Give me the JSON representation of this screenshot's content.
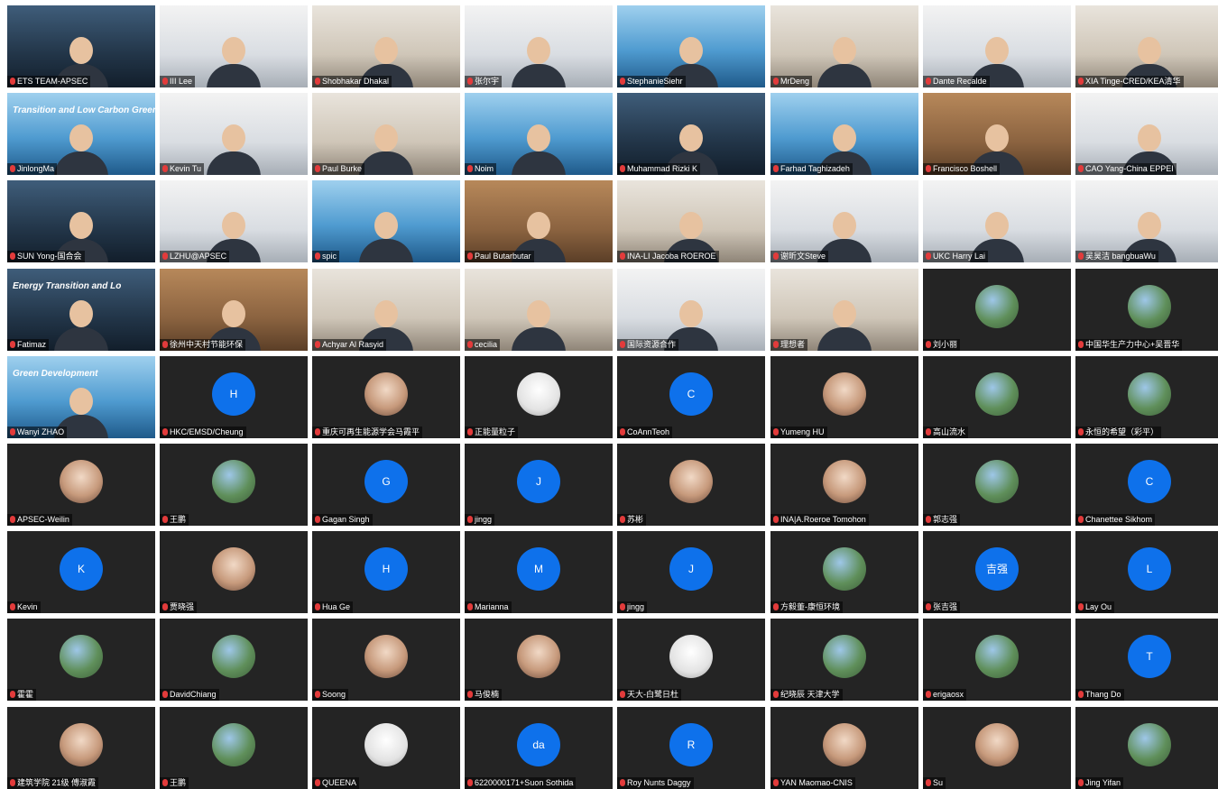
{
  "participants": [
    {
      "name": "ETS TEAM-APSEC",
      "kind": "video",
      "tone": "v4"
    },
    {
      "name": "III Lee",
      "kind": "video",
      "tone": "v3"
    },
    {
      "name": "Shobhakar Dhakal",
      "kind": "video",
      "tone": "v1"
    },
    {
      "name": "张尔宇",
      "kind": "video",
      "tone": "v3"
    },
    {
      "name": "StephanieSiehr",
      "kind": "video",
      "tone": "v2"
    },
    {
      "name": "MrDeng",
      "kind": "video",
      "tone": "v1"
    },
    {
      "name": "Dante Recalde",
      "kind": "video",
      "tone": "v3"
    },
    {
      "name": "XIA Tinge-CRED/KEA清华",
      "kind": "video",
      "tone": "v1"
    },
    {
      "name": "JinlongMa",
      "kind": "video",
      "tone": "v2",
      "banner": "Transition and Low Carbon Green D"
    },
    {
      "name": "Kevin Tu",
      "kind": "video",
      "tone": "v3"
    },
    {
      "name": "Paul Burke",
      "kind": "video",
      "tone": "v1"
    },
    {
      "name": "Noim",
      "kind": "video",
      "tone": "v2"
    },
    {
      "name": "Muhammad Rizki K",
      "kind": "video",
      "tone": "v4"
    },
    {
      "name": "Farhad Taghizadeh",
      "kind": "video",
      "tone": "v2"
    },
    {
      "name": "Francisco Boshell",
      "kind": "video",
      "tone": "v5"
    },
    {
      "name": "CAO Yang-China EPPEI",
      "kind": "video",
      "tone": "v3"
    },
    {
      "name": "SUN Yong-国合会",
      "kind": "video",
      "tone": "v4"
    },
    {
      "name": "LZHU@APSEC",
      "kind": "video",
      "tone": "v3"
    },
    {
      "name": "spic",
      "kind": "video",
      "tone": "v2"
    },
    {
      "name": "Paul Butarbutar",
      "kind": "video",
      "tone": "v5"
    },
    {
      "name": "INA-LI Jacoba ROEROE",
      "kind": "video",
      "tone": "v1"
    },
    {
      "name": "谢昕文Steve",
      "kind": "video",
      "tone": "v3"
    },
    {
      "name": "UKC Harry Lai",
      "kind": "video",
      "tone": "v3"
    },
    {
      "name": "吴昊洁 bangbuaWu",
      "kind": "video",
      "tone": "v3"
    },
    {
      "name": "Fatimaz",
      "kind": "video",
      "tone": "v4",
      "banner": "Energy Transition and Lo"
    },
    {
      "name": "徐州中天村节能环保",
      "kind": "video",
      "tone": "v5"
    },
    {
      "name": "Achyar Al Rasyid",
      "kind": "video",
      "tone": "v1"
    },
    {
      "name": "cecilia",
      "kind": "video",
      "tone": "v1"
    },
    {
      "name": "国际资源合作",
      "kind": "video",
      "tone": "v3"
    },
    {
      "name": "理想者",
      "kind": "video",
      "tone": "v1"
    },
    {
      "name": "刘小丽",
      "kind": "avatar",
      "style": "photo",
      "initial": ""
    },
    {
      "name": "中国华生产力中心+吴晋华",
      "kind": "avatar",
      "style": "photo",
      "initial": ""
    },
    {
      "name": "Wanyi ZHAO",
      "kind": "video",
      "tone": "v2",
      "banner": "Green Development"
    },
    {
      "name": "HKC/EMSD/Cheung",
      "kind": "avatar",
      "style": "",
      "initial": "H"
    },
    {
      "name": "重庆可再生能源学会马霞平",
      "kind": "avatar",
      "style": "photo2",
      "initial": ""
    },
    {
      "name": "正能量粒子",
      "kind": "avatar",
      "style": "photo3",
      "initial": ""
    },
    {
      "name": "CoAnnTeoh",
      "kind": "avatar",
      "style": "",
      "initial": "C"
    },
    {
      "name": "Yumeng HU",
      "kind": "avatar",
      "style": "photo2",
      "initial": ""
    },
    {
      "name": "高山流水",
      "kind": "avatar",
      "style": "photo",
      "initial": ""
    },
    {
      "name": "永恒的希望（彩平）",
      "kind": "avatar",
      "style": "photo",
      "initial": ""
    },
    {
      "name": "APSEC-Weilin",
      "kind": "avatar",
      "style": "photo2",
      "initial": ""
    },
    {
      "name": "王鹏",
      "kind": "avatar",
      "style": "photo",
      "initial": ""
    },
    {
      "name": "Gagan Singh",
      "kind": "avatar",
      "style": "",
      "initial": "G"
    },
    {
      "name": "jingg",
      "kind": "avatar",
      "style": "",
      "initial": "J"
    },
    {
      "name": "苏彬",
      "kind": "avatar",
      "style": "photo2",
      "initial": ""
    },
    {
      "name": "INA|A.Roeroe Tomohon",
      "kind": "avatar",
      "style": "photo2",
      "initial": ""
    },
    {
      "name": "郭志强",
      "kind": "avatar",
      "style": "photo",
      "initial": ""
    },
    {
      "name": "Chanettee Sikhom",
      "kind": "avatar",
      "style": "",
      "initial": "C"
    },
    {
      "name": "Kevin",
      "kind": "avatar",
      "style": "",
      "initial": "K"
    },
    {
      "name": "贾晓强",
      "kind": "avatar",
      "style": "photo2",
      "initial": ""
    },
    {
      "name": "Hua Ge",
      "kind": "avatar",
      "style": "",
      "initial": "H"
    },
    {
      "name": "Marianna",
      "kind": "avatar",
      "style": "",
      "initial": "M"
    },
    {
      "name": "jingg",
      "kind": "avatar",
      "style": "",
      "initial": "J"
    },
    {
      "name": "方毅董-康恒环境",
      "kind": "avatar",
      "style": "photo",
      "initial": ""
    },
    {
      "name": "张吉强",
      "kind": "avatar",
      "style": "",
      "initial": "吉强"
    },
    {
      "name": "Lay Ou",
      "kind": "avatar",
      "style": "",
      "initial": "L"
    },
    {
      "name": "霍霍",
      "kind": "avatar",
      "style": "photo",
      "initial": ""
    },
    {
      "name": "DavidChiang",
      "kind": "avatar",
      "style": "photo",
      "initial": ""
    },
    {
      "name": "Soong",
      "kind": "avatar",
      "style": "photo2",
      "initial": ""
    },
    {
      "name": "马俊楠",
      "kind": "avatar",
      "style": "photo2",
      "initial": ""
    },
    {
      "name": "天大-白鹭日杜",
      "kind": "avatar",
      "style": "photo3",
      "initial": ""
    },
    {
      "name": "纪晓辰 天津大学",
      "kind": "avatar",
      "style": "photo",
      "initial": ""
    },
    {
      "name": "erigaosx",
      "kind": "avatar",
      "style": "photo",
      "initial": ""
    },
    {
      "name": "Thang Do",
      "kind": "avatar",
      "style": "",
      "initial": "T"
    },
    {
      "name": "建筑学院 21级 傅淑霞",
      "kind": "avatar",
      "style": "photo2",
      "initial": ""
    },
    {
      "name": "王鹏",
      "kind": "avatar",
      "style": "photo",
      "initial": ""
    },
    {
      "name": "QUEENA",
      "kind": "avatar",
      "style": "photo3",
      "initial": ""
    },
    {
      "name": "6220000171+Suon Sothida",
      "kind": "avatar",
      "style": "",
      "initial": "da"
    },
    {
      "name": "Roy Nunts Daggy",
      "kind": "avatar",
      "style": "",
      "initial": "R"
    },
    {
      "name": "YAN Maomao-CNIS",
      "kind": "avatar",
      "style": "photo2",
      "initial": ""
    },
    {
      "name": "Su",
      "kind": "avatar",
      "style": "photo2",
      "initial": ""
    },
    {
      "name": "Jing Yifan",
      "kind": "avatar",
      "style": "photo",
      "initial": ""
    }
  ]
}
